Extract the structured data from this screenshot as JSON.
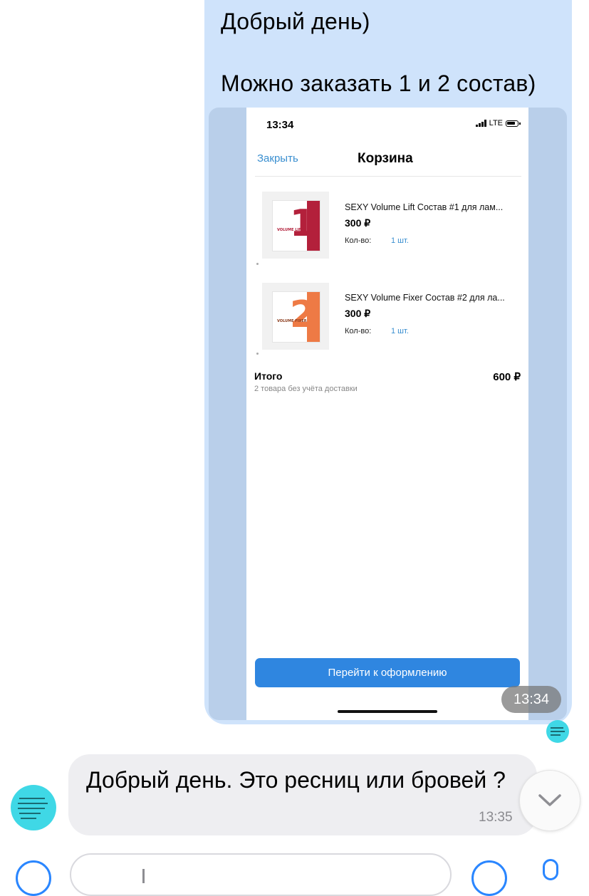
{
  "outgoing": {
    "line1": "Добрый день)",
    "line2": "Можно заказать 1 и 2 состав)",
    "time": "13:34"
  },
  "screenshot": {
    "status_time": "13:34",
    "network": "LTE",
    "close_label": "Закрыть",
    "title": "Корзина",
    "items": [
      {
        "name": "SEXY Volume Lift Состав #1 для лам...",
        "price": "300 ₽",
        "qty_label": "Кол-во:",
        "qty": "1 шт.",
        "digit": "1",
        "pack_label": "VOLUME LIFT",
        "color": "#b3203b"
      },
      {
        "name": "SEXY Volume Fixer Состав #2 для ла...",
        "price": "300 ₽",
        "qty_label": "Кол-во:",
        "qty": "1 шт.",
        "digit": "2",
        "pack_label": "VOLUME FIXER",
        "color": "#ee7a45"
      }
    ],
    "total_label": "Итого",
    "total_sub": "2 товара без учёта доставки",
    "total_value": "600 ₽",
    "checkout_label": "Перейти к оформлению"
  },
  "incoming": {
    "text": "Добрый день. Это ресниц или бровей ?",
    "time": "13:35"
  },
  "colors": {
    "outgoing_bubble": "#cfe3fb",
    "incoming_bubble": "#eeeef1",
    "accent": "#2a86ff",
    "avatar": "#3fd8e6"
  },
  "icons": [
    "chevron-down-icon",
    "attach-icon",
    "emoji-icon",
    "microphone-icon"
  ]
}
